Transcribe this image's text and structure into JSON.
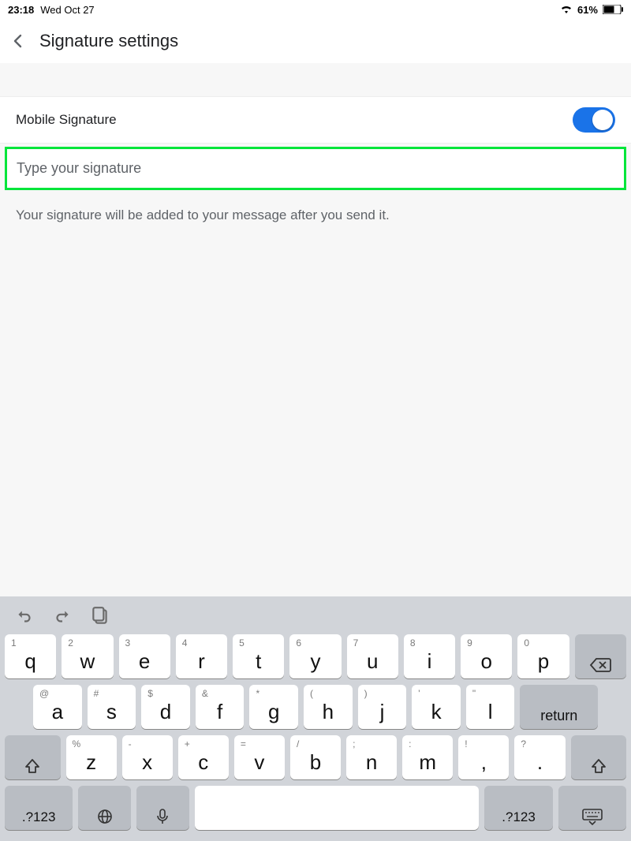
{
  "status": {
    "time": "23:18",
    "date": "Wed Oct 27",
    "battery": "61%"
  },
  "nav": {
    "title": "Signature settings"
  },
  "mobileSignature": {
    "label": "Mobile Signature"
  },
  "signatureInput": {
    "placeholder": "Type your signature"
  },
  "helper": "Your signature will be added to your message after you send it.",
  "kb": {
    "row1": [
      {
        "sec": "1",
        "pri": "q"
      },
      {
        "sec": "2",
        "pri": "w"
      },
      {
        "sec": "3",
        "pri": "e"
      },
      {
        "sec": "4",
        "pri": "r"
      },
      {
        "sec": "5",
        "pri": "t"
      },
      {
        "sec": "6",
        "pri": "y"
      },
      {
        "sec": "7",
        "pri": "u"
      },
      {
        "sec": "8",
        "pri": "i"
      },
      {
        "sec": "9",
        "pri": "o"
      },
      {
        "sec": "0",
        "pri": "p"
      }
    ],
    "row2": [
      {
        "sec": "@",
        "pri": "a"
      },
      {
        "sec": "#",
        "pri": "s"
      },
      {
        "sec": "$",
        "pri": "d"
      },
      {
        "sec": "&",
        "pri": "f"
      },
      {
        "sec": "*",
        "pri": "g"
      },
      {
        "sec": "(",
        "pri": "h"
      },
      {
        "sec": ")",
        "pri": "j"
      },
      {
        "sec": "'",
        "pri": "k"
      },
      {
        "sec": "\"",
        "pri": "l"
      }
    ],
    "returnLabel": "return",
    "row3": [
      {
        "sec": "%",
        "pri": "z"
      },
      {
        "sec": "-",
        "pri": "x"
      },
      {
        "sec": "+",
        "pri": "c"
      },
      {
        "sec": "=",
        "pri": "v"
      },
      {
        "sec": "/",
        "pri": "b"
      },
      {
        "sec": ";",
        "pri": "n"
      },
      {
        "sec": ":",
        "pri": "m"
      },
      {
        "sec": "!",
        "pri": ","
      },
      {
        "sec": "?",
        "pri": "."
      }
    ],
    "symLabel": ".?123"
  }
}
